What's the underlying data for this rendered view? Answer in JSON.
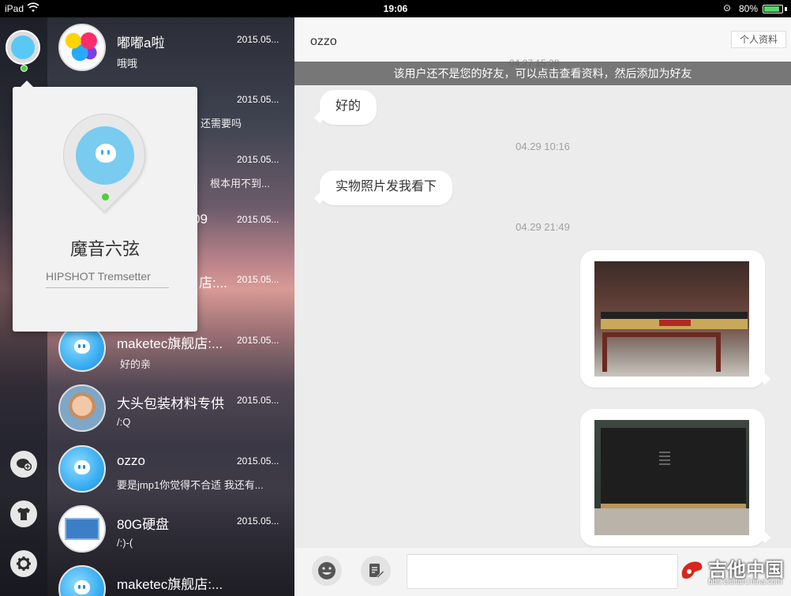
{
  "status_bar": {
    "device": "iPad",
    "time": "19:06",
    "battery": "80%",
    "battery_level": 0.8
  },
  "profile_popup": {
    "name": "魔音六弦",
    "signature": "HIPSHOT Tremsetter"
  },
  "conversations": [
    {
      "name": "嘟嘟a啦",
      "date": "2015.05...",
      "preview": "哦哦",
      "avatar": "colorful-circles"
    },
    {
      "name": "",
      "date": "2015.05...",
      "preview": "还需要吗",
      "avatar": "hidden"
    },
    {
      "name": "",
      "date": "2015.05...",
      "preview": "根本用不到...",
      "avatar": "hidden"
    },
    {
      "name": "09",
      "date": "2015.05...",
      "preview": "",
      "avatar": "hidden"
    },
    {
      "name": "店:...",
      "date": "2015.05...",
      "preview": "",
      "avatar": "hidden"
    },
    {
      "name": "maketec旗舰店:...",
      "date": "2015.05...",
      "preview": "好的亲",
      "avatar": "default-blue"
    },
    {
      "name": "大头包装材料专供",
      "date": "2015.05...",
      "preview": "/:Q",
      "avatar": "baby-photo"
    },
    {
      "name": "ozzo",
      "date": "2015.05...",
      "preview": "要是jmp1你觉得不合适  我还有...",
      "avatar": "default-blue"
    },
    {
      "name": "80G硬盘",
      "date": "2015.05...",
      "preview": "/:)-(",
      "avatar": "disk-card"
    },
    {
      "name": "maketec旗舰店:...",
      "date": "",
      "preview": "",
      "avatar": "default-blue"
    }
  ],
  "chat": {
    "title": "ozzo",
    "profile_button": "个人资料",
    "ghost_time": "04.27 15:28",
    "notice": "该用户还不是您的好友，可以点击查看资料，然后添加为好友",
    "messages": [
      {
        "type": "text",
        "side": "left",
        "text": "好的"
      },
      {
        "type": "time",
        "text": "04.29 10:16"
      },
      {
        "type": "text",
        "side": "left",
        "text": "实物照片发我看下"
      },
      {
        "type": "time",
        "text": "04.29 21:49"
      },
      {
        "type": "image",
        "side": "right",
        "content": "amplifier-on-chair-photo"
      },
      {
        "type": "image",
        "side": "right",
        "content": "black-device-box-photo"
      }
    ]
  },
  "input_bar": {
    "emoji_icon": "smiley-icon",
    "edit_icon": "edit-note-icon",
    "text_value": ""
  },
  "watermark": {
    "title": "吉他中国",
    "url": "bbs.GuitarChina.com"
  },
  "rail_icons": [
    "add-chat-icon",
    "tshirt-icon",
    "gear-icon"
  ],
  "colors": {
    "accent_blue": "#3aaef2",
    "online_green": "#4cd137",
    "notice_bg": "#5a5a5a",
    "watermark_red": "#d7261e"
  }
}
